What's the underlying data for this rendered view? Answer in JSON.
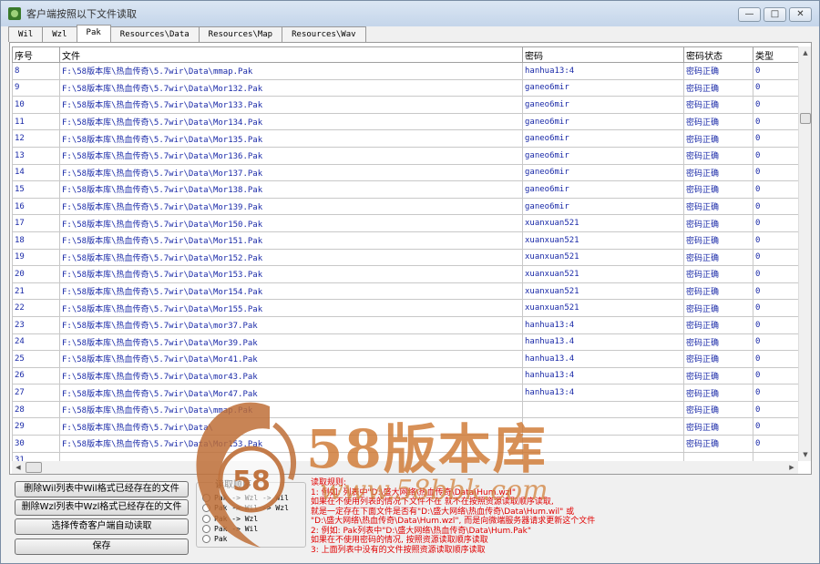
{
  "window": {
    "title": "客户端按照以下文件读取",
    "minimize": "—",
    "maximize": "□",
    "close": "✕"
  },
  "tabs": [
    "Wil",
    "Wzl",
    "Pak",
    "Resources\\Data",
    "Resources\\Map",
    "Resources\\Wav"
  ],
  "table": {
    "headers": [
      "序号",
      "文件",
      "密码",
      "密码状态",
      "类型"
    ],
    "rows": [
      [
        "8",
        "F:\\58版本库\\热血传奇\\5.7wir\\Data\\mmap.Pak",
        "hanhua13:4",
        "密码正确",
        "0"
      ],
      [
        "9",
        "F:\\58版本库\\热血传奇\\5.7wir\\Data\\Mor132.Pak",
        "ganeo6mir",
        "密码正确",
        "0"
      ],
      [
        "10",
        "F:\\58版本库\\热血传奇\\5.7wir\\Data\\Mor133.Pak",
        "ganeo6mir",
        "密码正确",
        "0"
      ],
      [
        "11",
        "F:\\58版本库\\热血传奇\\5.7wir\\Data\\Mor134.Pak",
        "ganeo6mir",
        "密码正确",
        "0"
      ],
      [
        "12",
        "F:\\58版本库\\热血传奇\\5.7wir\\Data\\Mor135.Pak",
        "ganeo6mir",
        "密码正确",
        "0"
      ],
      [
        "13",
        "F:\\58版本库\\热血传奇\\5.7wir\\Data\\Mor136.Pak",
        "ganeo6mir",
        "密码正确",
        "0"
      ],
      [
        "14",
        "F:\\58版本库\\热血传奇\\5.7wir\\Data\\Mor137.Pak",
        "ganeo6mir",
        "密码正确",
        "0"
      ],
      [
        "15",
        "F:\\58版本库\\热血传奇\\5.7wir\\Data\\Mor138.Pak",
        "ganeo6mir",
        "密码正确",
        "0"
      ],
      [
        "16",
        "F:\\58版本库\\热血传奇\\5.7wir\\Data\\Mor139.Pak",
        "ganeo6mir",
        "密码正确",
        "0"
      ],
      [
        "17",
        "F:\\58版本库\\热血传奇\\5.7wir\\Data\\Mor150.Pak",
        "xuanxuan521",
        "密码正确",
        "0"
      ],
      [
        "18",
        "F:\\58版本库\\热血传奇\\5.7wir\\Data\\Mor151.Pak",
        "xuanxuan521",
        "密码正确",
        "0"
      ],
      [
        "19",
        "F:\\58版本库\\热血传奇\\5.7wir\\Data\\Mor152.Pak",
        "xuanxuan521",
        "密码正确",
        "0"
      ],
      [
        "20",
        "F:\\58版本库\\热血传奇\\5.7wir\\Data\\Mor153.Pak",
        "xuanxuan521",
        "密码正确",
        "0"
      ],
      [
        "21",
        "F:\\58版本库\\热血传奇\\5.7wir\\Data\\Mor154.Pak",
        "xuanxuan521",
        "密码正确",
        "0"
      ],
      [
        "22",
        "F:\\58版本库\\热血传奇\\5.7wir\\Data\\Mor155.Pak",
        "xuanxuan521",
        "密码正确",
        "0"
      ],
      [
        "23",
        "F:\\58版本库\\热血传奇\\5.7wir\\Data\\mor37.Pak",
        "hanhua13:4",
        "密码正确",
        "0"
      ],
      [
        "24",
        "F:\\58版本库\\热血传奇\\5.7wir\\Data\\Mor39.Pak",
        "hanhua13.4",
        "密码正确",
        "0"
      ],
      [
        "25",
        "F:\\58版本库\\热血传奇\\5.7wir\\Data\\Mor41.Pak",
        "hanhua13.4",
        "密码正确",
        "0"
      ],
      [
        "26",
        "F:\\58版本库\\热血传奇\\5.7wir\\Data\\mor43.Pak",
        "hanhua13:4",
        "密码正确",
        "0"
      ],
      [
        "27",
        "F:\\58版本库\\热血传奇\\5.7wir\\Data\\Mor47.Pak",
        "hanhua13:4",
        "密码正确",
        "0"
      ],
      [
        "28",
        "F:\\58版本库\\热血传奇\\5.7wir\\Data\\mmap.Pak",
        "",
        "密码正确",
        "0"
      ],
      [
        "29",
        "F:\\58版本库\\热血传奇\\5.7wir\\Data\\",
        "",
        "密码正确",
        "0"
      ],
      [
        "30",
        "F:\\58版本库\\热血传奇\\5.7wir\\Data\\Mor153.Pak",
        "",
        "密码正确",
        "0"
      ],
      [
        "31",
        "",
        "",
        "",
        ""
      ]
    ]
  },
  "buttons": {
    "delete_wil": "删除Wil列表中Wil格式已经存在的文件",
    "delete_wzl": "删除Wzl列表中Wzl格式已经存在的文件",
    "select_client": "选择传奇客户端自动读取",
    "save": "保存"
  },
  "read_order": {
    "title": "读取顺序",
    "options": [
      "Pak -> Wzl -> Wil",
      "Pak -> Wil -> Wzl",
      "Pak -> Wzl",
      "Pak -> Wil",
      "Pak"
    ]
  },
  "notes": [
    "读取规则:",
    "1: 例如: 列表中\"D:\\盛大网络\\热血传奇\\Data\\Hum.wzl\"",
    "   如果在不使用列表的情况下文件不在 就不在按照资源读取顺序读取,",
    "   就是一定存在下面文件是否有\"D:\\盛大网络\\热血传奇\\Data\\Hum.wil\" 或",
    "   \"D:\\盛大网络\\热血传奇\\Data\\Hum.wzl\", 而是向微端服务器请求更新这个文件",
    "2: 例如: Pak列表中\"D:\\盛大网络\\热血传奇\\Data\\Hum.Pak\"",
    "   如果在不使用密码的情况, 按照资源读取顺序读取",
    "3: 上面列表中没有的文件按照资源读取顺序读取"
  ],
  "watermark": {
    "brand": "58版本库",
    "url": "www.58bbk.com",
    "badge": "58"
  },
  "colors": {
    "row_text": "#1a2aa8",
    "notes_text": "#e00000",
    "watermark": "#ce7832"
  }
}
